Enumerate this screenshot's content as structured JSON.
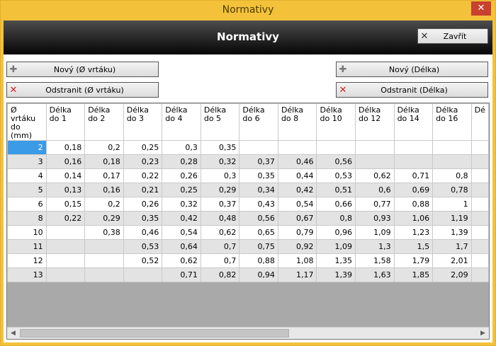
{
  "window": {
    "title": "Normativy",
    "close_glyph": "✕"
  },
  "header": {
    "title": "Normativy",
    "close_button": "Zavřít"
  },
  "buttons": {
    "new_diameter": "Nový (Ø vrtáku)",
    "delete_diameter": "Odstranit (Ø vrtáku)",
    "new_length": "Nový (Délka)",
    "delete_length": "Odstranit (Délka)"
  },
  "icons": {
    "plus": "plus-icon",
    "close": "close-icon",
    "delete": "delete-icon"
  },
  "colors": {
    "titlebar": "#f3c23a",
    "selection": "#3c9be6",
    "delete_icon": "#d02020"
  },
  "table": {
    "headers": [
      [
        "Ø vrtáku",
        "do (mm)"
      ],
      [
        "Délka",
        "do 1"
      ],
      [
        "Délka",
        "do 2"
      ],
      [
        "Délka",
        "do 3"
      ],
      [
        "Délka",
        "do 4"
      ],
      [
        "Délka",
        "do 5"
      ],
      [
        "Délka",
        "do 6"
      ],
      [
        "Délka",
        "do 8"
      ],
      [
        "Délka",
        "do 10"
      ],
      [
        "Délka",
        "do 12"
      ],
      [
        "Délka",
        "do 14"
      ],
      [
        "Délka",
        "do 16"
      ],
      [
        "Dé",
        ""
      ]
    ],
    "rows": [
      [
        "2",
        "0,18",
        "0,2",
        "0,25",
        "0,3",
        "0,35",
        "",
        "",
        "",
        "",
        "",
        "",
        ""
      ],
      [
        "3",
        "0,16",
        "0,18",
        "0,23",
        "0,28",
        "0,32",
        "0,37",
        "0,46",
        "0,56",
        "",
        "",
        "",
        ""
      ],
      [
        "4",
        "0,14",
        "0,17",
        "0,22",
        "0,26",
        "0,3",
        "0,35",
        "0,44",
        "0,53",
        "0,62",
        "0,71",
        "0,8",
        ""
      ],
      [
        "5",
        "0,13",
        "0,16",
        "0,21",
        "0,25",
        "0,29",
        "0,34",
        "0,42",
        "0,51",
        "0,6",
        "0,69",
        "0,78",
        ""
      ],
      [
        "6",
        "0,15",
        "0,2",
        "0,26",
        "0,32",
        "0,37",
        "0,43",
        "0,54",
        "0,66",
        "0,77",
        "0,88",
        "1",
        ""
      ],
      [
        "8",
        "0,22",
        "0,29",
        "0,35",
        "0,42",
        "0,48",
        "0,56",
        "0,67",
        "0,8",
        "0,93",
        "1,06",
        "1,19",
        ""
      ],
      [
        "10",
        "",
        "0,38",
        "0,46",
        "0,54",
        "0,62",
        "0,65",
        "0,79",
        "0,96",
        "1,09",
        "1,23",
        "1,39",
        ""
      ],
      [
        "11",
        "",
        "",
        "0,53",
        "0,64",
        "0,7",
        "0,75",
        "0,92",
        "1,09",
        "1,3",
        "1,5",
        "1,7",
        ""
      ],
      [
        "12",
        "",
        "",
        "0,52",
        "0,62",
        "0,7",
        "0,88",
        "1,08",
        "1,35",
        "1,58",
        "1,79",
        "2,01",
        ""
      ],
      [
        "13",
        "",
        "",
        "",
        "0,71",
        "0,82",
        "0,94",
        "1,17",
        "1,39",
        "1,63",
        "1,85",
        "2,09",
        ""
      ]
    ]
  },
  "scrollbar": {
    "left_arrow": "◀",
    "right_arrow": "▶"
  }
}
